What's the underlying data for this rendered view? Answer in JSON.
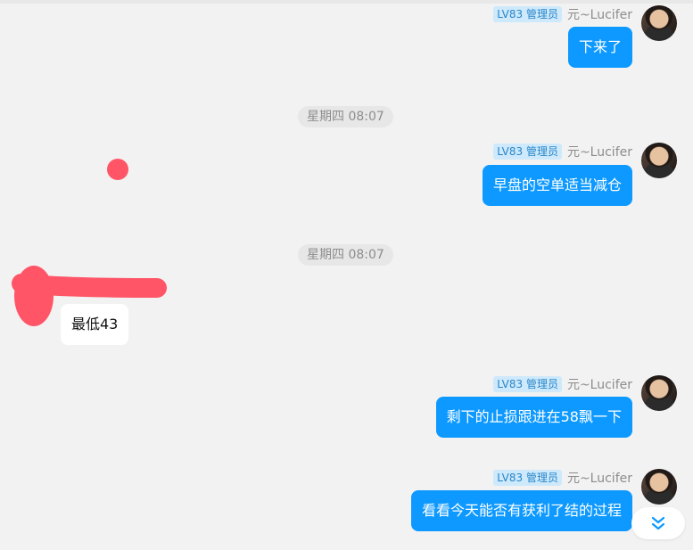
{
  "colors": {
    "background": "#f2f2f3",
    "outgoing_bubble": "#0d99ff",
    "incoming_bubble": "#ffffff",
    "badge_bg": "#cde9fb",
    "badge_text": "#2a86c9",
    "scribble": "#ff5567"
  },
  "messages": [
    {
      "badge": "LV83 管理员",
      "sender": "元~Lucifer",
      "text": "下来了",
      "avatar_icon": "user-avatar-icon"
    },
    {
      "badge": "LV83 管理员",
      "sender": "元~Lucifer",
      "text": "早盘的空单适当减仓",
      "avatar_icon": "user-avatar-icon"
    },
    {
      "badge": "LV83 管理员",
      "sender": "元~Lucifer",
      "text": "剩下的止损跟进在58飘一下",
      "avatar_icon": "user-avatar-icon"
    },
    {
      "badge": "LV83 管理员",
      "sender": "元~Lucifer",
      "text": "看看今天能否有获利了结的过程",
      "avatar_icon": "user-avatar-icon"
    }
  ],
  "timestamps": [
    "星期四 08:07",
    "星期四 08:07"
  ],
  "incoming": {
    "text": "最低43"
  },
  "scroll_button": {
    "icon": "double-chevron-down-icon"
  }
}
